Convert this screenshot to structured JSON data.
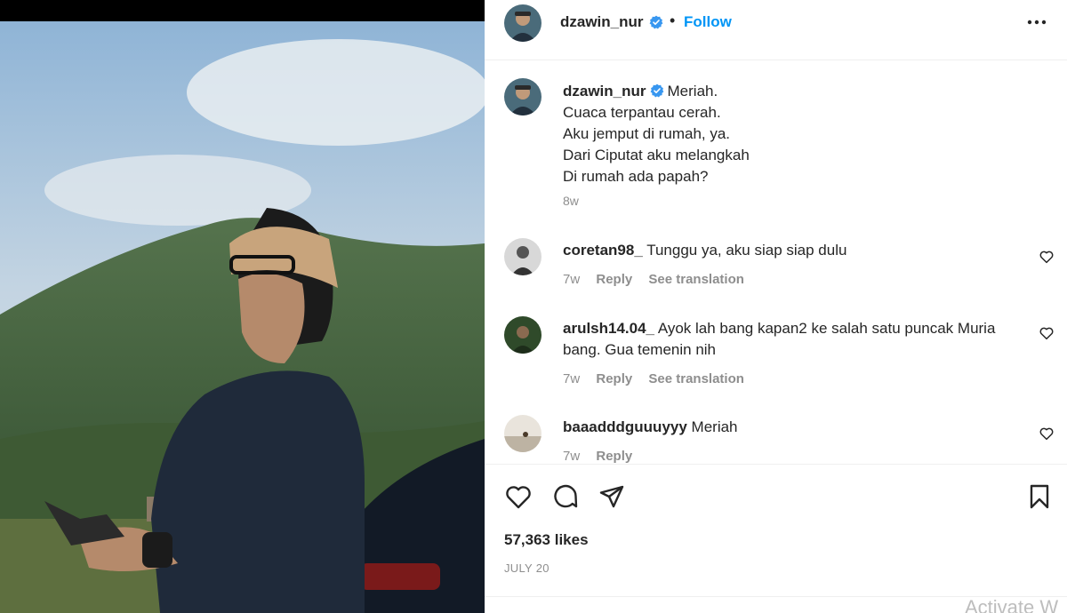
{
  "post": {
    "author": "dzawin_nur",
    "follow_label": "Follow",
    "dot": "•",
    "caption_lines": [
      "Meriah.",
      "Cuaca terpantau cerah.",
      "Aku jemput di rumah, ya.",
      "Dari Ciputat aku melangkah",
      "Di rumah ada papah?"
    ],
    "caption_time": "8w",
    "likes": "57,363 likes",
    "date": "JULY 20"
  },
  "comments": [
    {
      "user": "coretan98_",
      "text": "Tunggu ya, aku siap siap dulu",
      "time": "7w",
      "reply": "Reply",
      "translate": "See translation"
    },
    {
      "user": "arulsh14.04_",
      "text": "Ayok lah bang kapan2 ke salah satu puncak Muria bang. Gua temenin nih",
      "time": "7w",
      "reply": "Reply",
      "translate": "See translation"
    },
    {
      "user": "baaadddguuuyyy",
      "text": "Meriah",
      "time": "7w",
      "reply": "Reply"
    }
  ],
  "watermark": "Activate W",
  "colors": {
    "accent": "#0095f6",
    "verified": "#3897f0",
    "muted": "#8e8e8e",
    "text": "#262626"
  },
  "icons": [
    "verified-badge-icon",
    "more-options-icon",
    "heart-icon",
    "comment-icon",
    "share-icon",
    "bookmark-icon"
  ]
}
